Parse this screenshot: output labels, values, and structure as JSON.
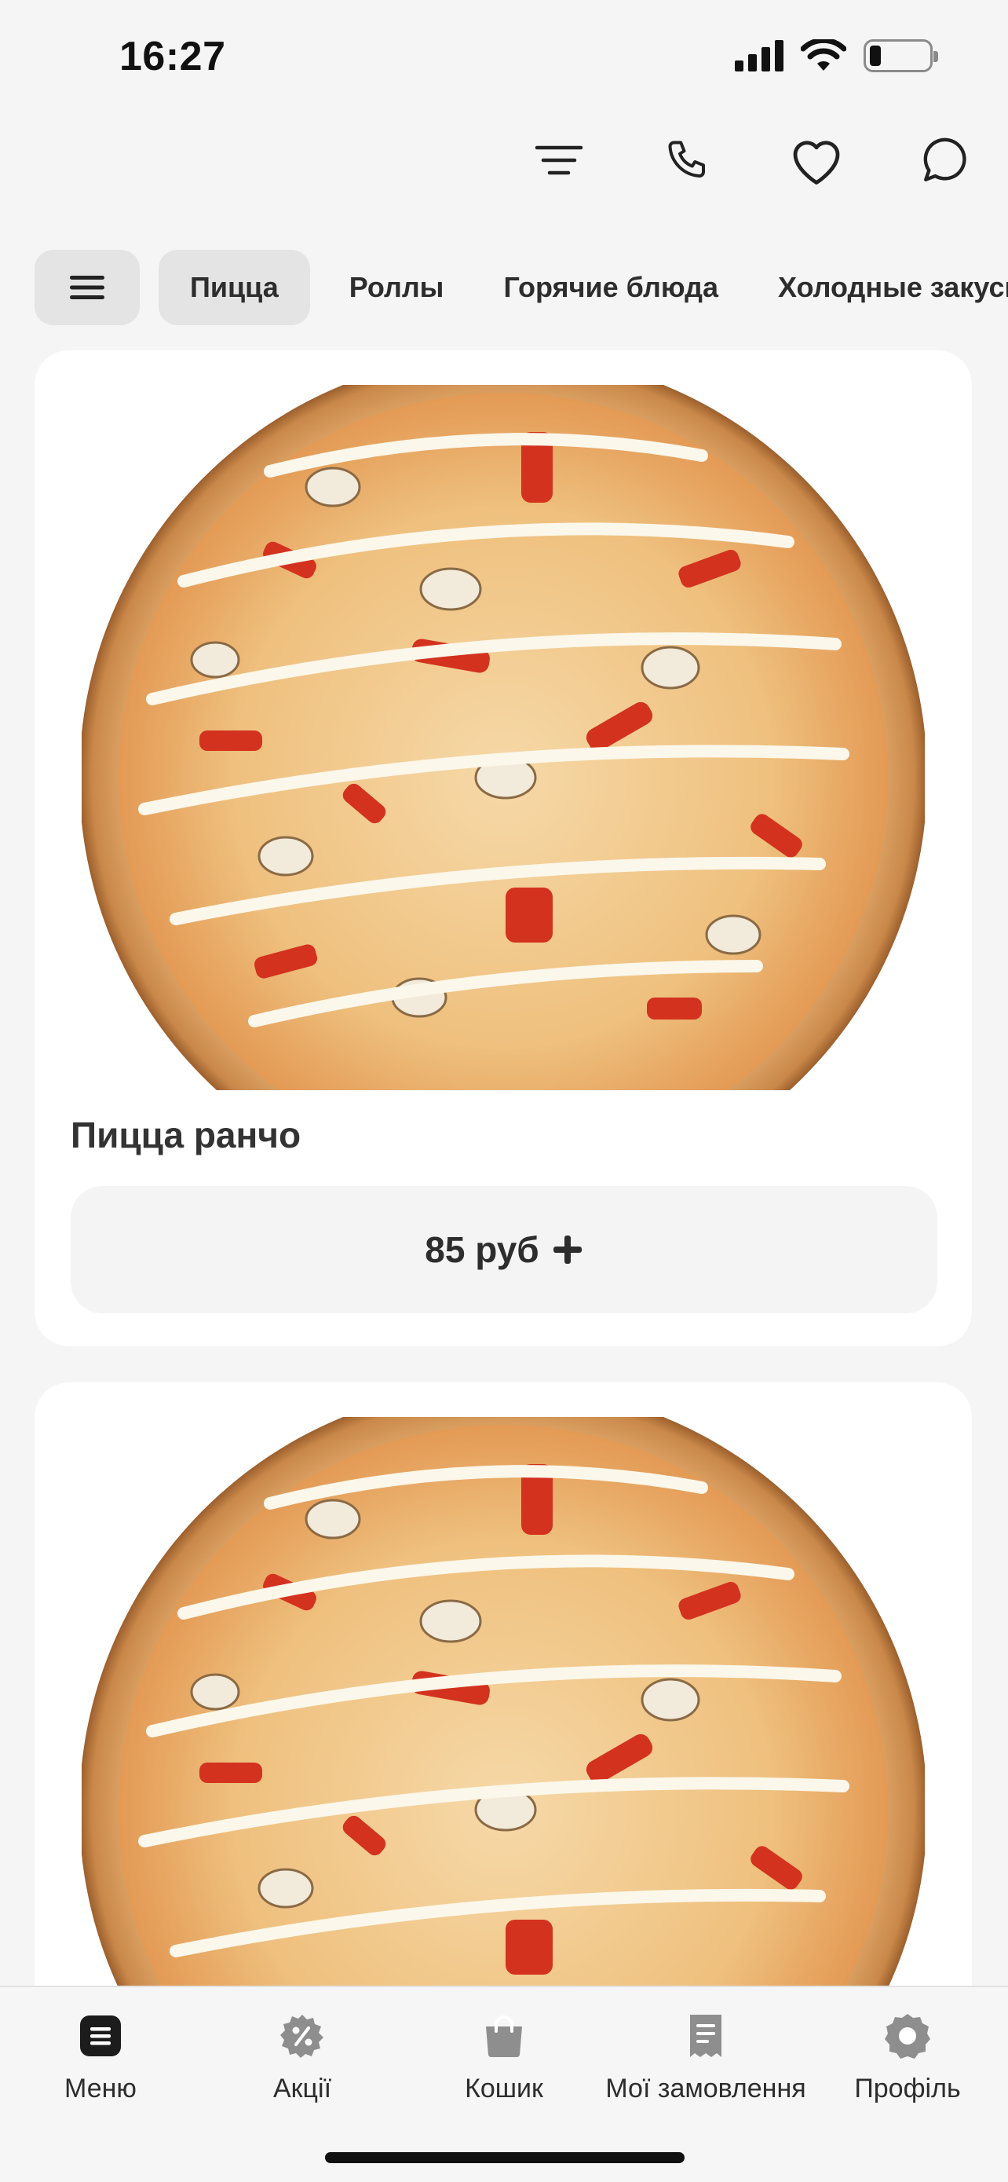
{
  "status_bar": {
    "time": "16:27",
    "battery_level": 0.2
  },
  "header": {
    "actions": [
      {
        "icon": "filter-icon"
      },
      {
        "icon": "phone-icon"
      },
      {
        "icon": "heart-icon"
      },
      {
        "icon": "chat-icon"
      }
    ]
  },
  "categories": {
    "menu_icon": "hamburger-menu-icon",
    "items": [
      {
        "label": "Пицца",
        "active": true
      },
      {
        "label": "Роллы",
        "active": false
      },
      {
        "label": "Горячие блюда",
        "active": false
      },
      {
        "label": "Холодные закуски",
        "active": false
      }
    ]
  },
  "products": [
    {
      "name": "Пицца ранчо",
      "price": "85 руб",
      "add_icon": "plus-icon"
    },
    {
      "name": "",
      "price": ""
    }
  ],
  "bottom_nav": {
    "items": [
      {
        "label": "Меню",
        "icon": "menu-list-icon",
        "active": true
      },
      {
        "label": "Акції",
        "icon": "discount-icon",
        "active": false
      },
      {
        "label": "Кошик",
        "icon": "bag-icon",
        "active": false
      },
      {
        "label": "Мої замовлення",
        "icon": "receipt-icon",
        "active": false
      },
      {
        "label": "Профіль",
        "icon": "profile-icon",
        "active": false
      }
    ]
  },
  "colors": {
    "background": "#f5f5f5",
    "card": "#ffffff",
    "chip": "#e4e4e4",
    "text": "#2d2d2d",
    "icon_inactive": "#8e8e8e"
  }
}
